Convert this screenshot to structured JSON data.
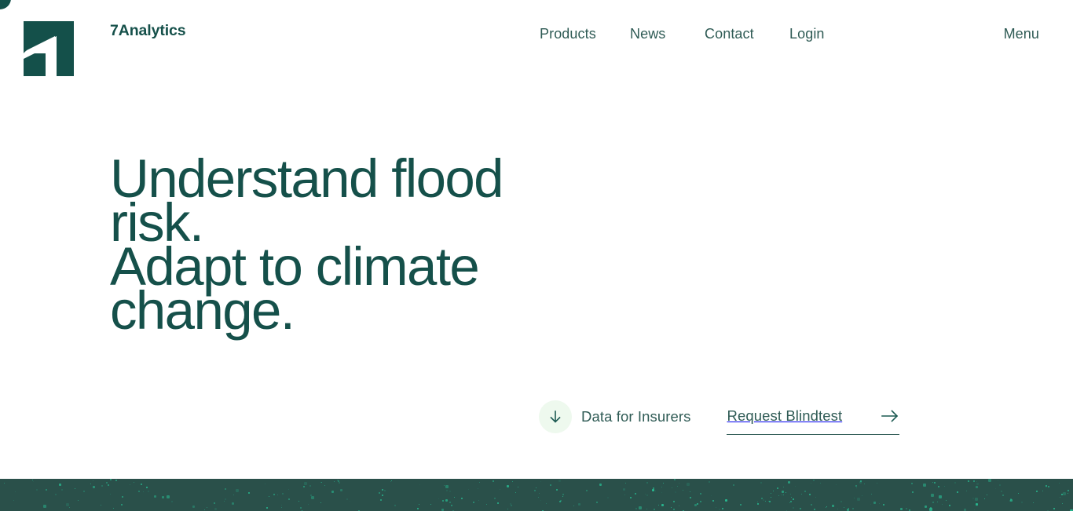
{
  "brand": {
    "name": "7Analytics",
    "logo_icon": "seven-analytics-logo-icon",
    "logo_color": "#14504A"
  },
  "colors": {
    "primary_green": "#15504A",
    "nav_text": "#2F5B55",
    "band_green": "#2A504A",
    "band_speck": "#28C79A",
    "circle_mint": "#EEF9EE",
    "page_background": "#FFFFFF"
  },
  "header": {
    "nav": [
      {
        "label": "Products"
      },
      {
        "label": "News"
      },
      {
        "label": "Contact"
      },
      {
        "label": "Login"
      }
    ],
    "menu_label": "Menu"
  },
  "hero": {
    "title_lines": [
      "Understand flood",
      "risk.",
      "Adapt to climate",
      "change."
    ]
  },
  "cta": {
    "anchor": {
      "label": "Data for Insurers",
      "icon": "arrow-down-icon"
    },
    "blindtest": {
      "label": "Request Blindtest",
      "icon": "arrow-right-icon"
    }
  }
}
